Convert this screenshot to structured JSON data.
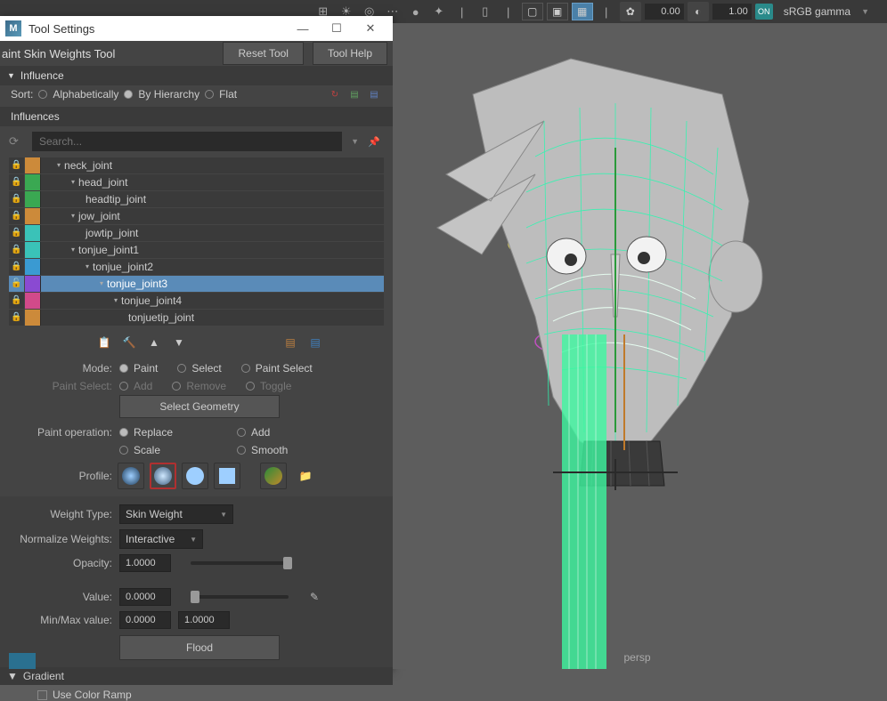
{
  "topbar": {
    "num1": "0.00",
    "num2": "1.00",
    "srgb_badge": "ON",
    "srgb_label": "sRGB gamma",
    "icons": [
      "grid-icon",
      "sun-icon",
      "circles-icon",
      "sphere-icon",
      "gizmo-icon",
      "ruler-icon",
      "box1-icon",
      "box2-icon",
      "box3-icon",
      "box-active-icon",
      "aperture-icon",
      "separator-icon"
    ]
  },
  "panel": {
    "window_title": "Tool Settings",
    "m_logo": "M",
    "tool_name": "aint Skin Weights Tool",
    "reset_btn": "Reset Tool",
    "help_btn": "Tool Help"
  },
  "influence": {
    "header": "Influence",
    "sort_label": "Sort:",
    "sort_options": [
      {
        "label": "Alphabetically",
        "on": false
      },
      {
        "label": "By Hierarchy",
        "on": true
      },
      {
        "label": "Flat",
        "on": false
      }
    ],
    "influences_label": "Influences",
    "search_placeholder": "Search...",
    "joints": [
      {
        "name": "neck_joint",
        "depth": 0,
        "arrow": true,
        "color": "#cc8a3a",
        "selected": false
      },
      {
        "name": "head_joint",
        "depth": 1,
        "arrow": true,
        "color": "#3aa852",
        "selected": false
      },
      {
        "name": "headtip_joint",
        "depth": 2,
        "arrow": false,
        "color": "#3aa852",
        "selected": false
      },
      {
        "name": "jow_joint",
        "depth": 1,
        "arrow": true,
        "color": "#cc8a3a",
        "selected": false
      },
      {
        "name": "jowtip_joint",
        "depth": 2,
        "arrow": false,
        "color": "#3ac2b8",
        "selected": false
      },
      {
        "name": "tonjue_joint1",
        "depth": 1,
        "arrow": true,
        "color": "#3ac2b8",
        "selected": false
      },
      {
        "name": "tonjue_joint2",
        "depth": 2,
        "arrow": true,
        "color": "#3a9ad2",
        "selected": false
      },
      {
        "name": "tonjue_joint3",
        "depth": 3,
        "arrow": true,
        "color": "#8a4ad2",
        "selected": true
      },
      {
        "name": "tonjue_joint4",
        "depth": 4,
        "arrow": true,
        "color": "#d24a8a",
        "selected": false
      },
      {
        "name": "tonjuetip_joint",
        "depth": 5,
        "arrow": false,
        "color": "#cc8a3a",
        "selected": false
      }
    ],
    "mode_label": "Mode:",
    "mode_options": [
      "Paint",
      "Select",
      "Paint Select"
    ],
    "mode_selected": 0,
    "paint_select_label": "Paint Select:",
    "ps_options": [
      "Add",
      "Remove",
      "Toggle"
    ],
    "select_geometry": "Select Geometry",
    "paint_op_label": "Paint operation:",
    "paint_op_left": [
      "Replace",
      "Scale"
    ],
    "paint_op_right": [
      "Add",
      "Smooth"
    ],
    "profile_label": "Profile:"
  },
  "weights": {
    "type_label": "Weight Type:",
    "type_value": "Skin Weight",
    "norm_label": "Normalize Weights:",
    "norm_value": "Interactive",
    "opacity_label": "Opacity:",
    "opacity_value": "1.0000",
    "value_label": "Value:",
    "value_value": "0.0000",
    "minmax_label": "Min/Max value:",
    "min_value": "0.0000",
    "max_value": "1.0000",
    "flood": "Flood"
  },
  "gradient": {
    "header": "Gradient",
    "use_ramp": "Use Color Ramp"
  },
  "viewport": {
    "camera_label": "persp"
  }
}
